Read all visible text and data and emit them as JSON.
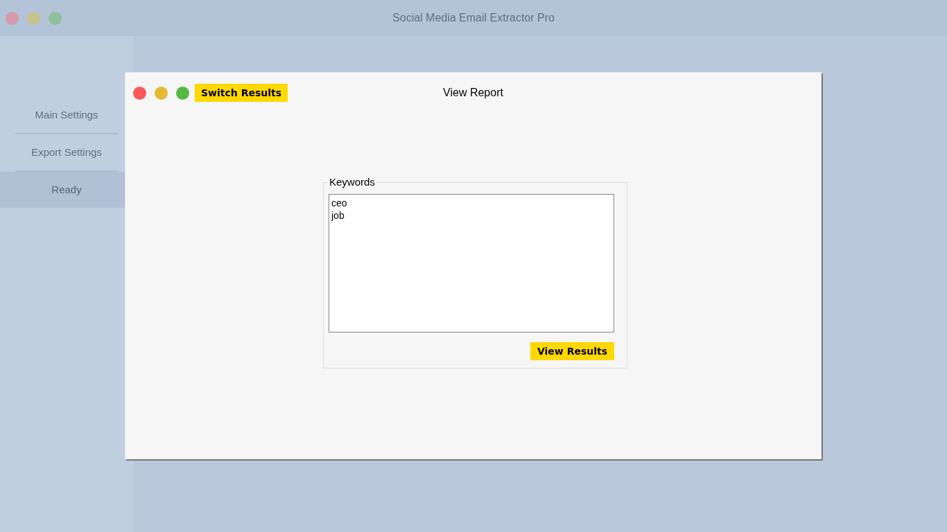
{
  "window": {
    "title": "Social Media Email Extractor Pro"
  },
  "sidebar": {
    "items": [
      {
        "label": "Main Settings",
        "selected": false
      },
      {
        "label": "Export Settings",
        "selected": false
      },
      {
        "label": "Ready",
        "selected": true
      }
    ]
  },
  "dialog": {
    "title": "View Report",
    "switch_button": "Switch Results",
    "keywords": {
      "label": "Keywords",
      "value": "ceo\njob"
    },
    "view_button": "View Results"
  }
}
